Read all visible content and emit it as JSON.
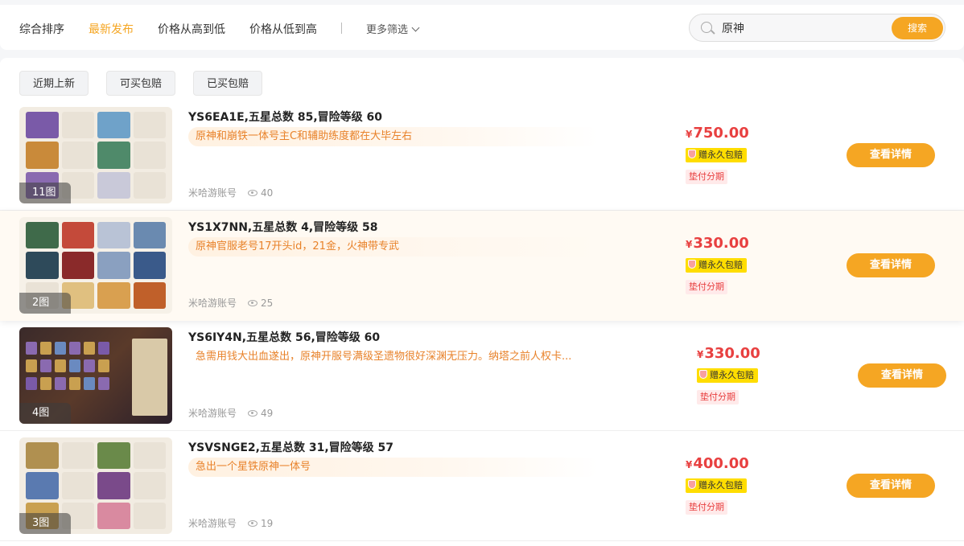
{
  "sort_tabs": [
    {
      "label": "综合排序",
      "active": false
    },
    {
      "label": "最新发布",
      "active": true
    },
    {
      "label": "价格从高到低",
      "active": false
    },
    {
      "label": "价格从低到高",
      "active": false
    }
  ],
  "more_filter_label": "更多筛选",
  "search": {
    "value": "原神",
    "button_label": "搜索"
  },
  "filter_chips": [
    "近期上新",
    "可买包赔",
    "已买包赔"
  ],
  "listings": [
    {
      "title": "YS6EA1E,五星总数 85,冒险等级 60",
      "tagline": "原神和崩铁一体号主C和辅助练度都在大毕左右",
      "image_count": "11图",
      "source": "米哈游账号",
      "views": "40",
      "currency": "¥",
      "price": "750.00",
      "insurance_badge": "赠永久包赔",
      "installment_badge": "垫付分期",
      "detail_button": "查看详情"
    },
    {
      "title": "YS1X7NN,五星总数 4,冒险等级 58",
      "tagline": "原神官服老号17开头id，21金，火神带专武",
      "image_count": "2图",
      "source": "米哈游账号",
      "views": "25",
      "currency": "¥",
      "price": "330.00",
      "insurance_badge": "赠永久包赔",
      "installment_badge": "垫付分期",
      "detail_button": "查看详情"
    },
    {
      "title": "YS6IY4N,五星总数 56,冒险等级 60",
      "tagline": "急需用钱大出血遂出，原神开服号满级圣遗物很好深渊无压力。纳塔之前人权卡...",
      "image_count": "4图",
      "source": "米哈游账号",
      "views": "49",
      "currency": "¥",
      "price": "330.00",
      "insurance_badge": "赠永久包赔",
      "installment_badge": "垫付分期",
      "detail_button": "查看详情"
    },
    {
      "title": "YSVSNGE2,五星总数 31,冒险等级 57",
      "tagline": "急出一个星铁原神一体号",
      "image_count": "3图",
      "source": "米哈游账号",
      "views": "19",
      "currency": "¥",
      "price": "400.00",
      "insurance_badge": "赠永久包赔",
      "installment_badge": "垫付分期",
      "detail_button": "查看详情"
    }
  ],
  "colors": {
    "accent": "#f5a623",
    "price": "#e84040",
    "tagline": "#e8822a",
    "insurance": "#ffdd00"
  }
}
